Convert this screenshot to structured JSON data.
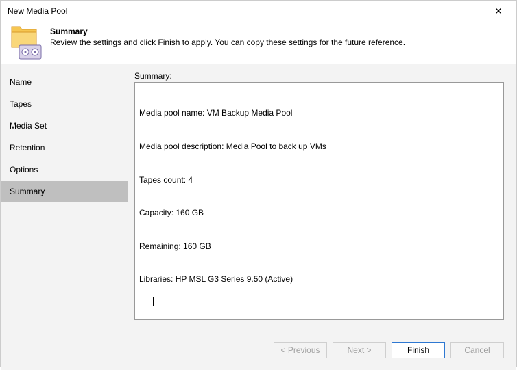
{
  "window": {
    "title": "New Media Pool",
    "close_glyph": "✕"
  },
  "header": {
    "title": "Summary",
    "description": "Review the settings and click Finish to apply. You can copy these settings for the future reference."
  },
  "sidebar": {
    "items": [
      {
        "label": "Name"
      },
      {
        "label": "Tapes"
      },
      {
        "label": "Media Set"
      },
      {
        "label": "Retention"
      },
      {
        "label": "Options"
      },
      {
        "label": "Summary"
      }
    ],
    "active_index": 5
  },
  "content": {
    "label": "Summary:",
    "lines": [
      "Media pool name: VM Backup Media Pool",
      "Media pool description: Media Pool to back up VMs",
      "Tapes count: 4",
      "Capacity: 160 GB",
      "Remaining: 160 GB",
      "Libraries: HP MSL G3 Series 9.50 (Active)"
    ]
  },
  "footer": {
    "previous": "< Previous",
    "next": "Next >",
    "finish": "Finish",
    "cancel": "Cancel"
  }
}
